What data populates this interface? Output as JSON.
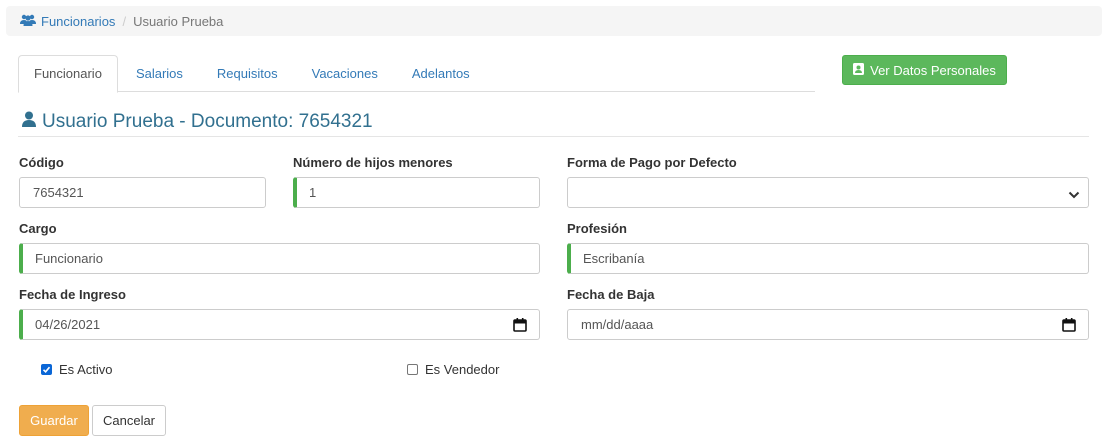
{
  "breadcrumb": {
    "parent": "Funcionarios",
    "current": "Usuario Prueba"
  },
  "tabs": [
    {
      "label": "Funcionario",
      "active": true
    },
    {
      "label": "Salarios"
    },
    {
      "label": "Requisitos"
    },
    {
      "label": "Vacaciones"
    },
    {
      "label": "Adelantos"
    }
  ],
  "personal_button": "Ver Datos Personales",
  "heading": "Usuario Prueba - Documento: 7654321",
  "form": {
    "codigo": {
      "label": "Código",
      "value": "7654321"
    },
    "hijos": {
      "label": "Número de hijos menores",
      "value": "1"
    },
    "forma_pago": {
      "label": "Forma de Pago por Defecto",
      "value": ""
    },
    "cargo": {
      "label": "Cargo",
      "value": "Funcionario"
    },
    "profesion": {
      "label": "Profesión",
      "value": "Escribanía"
    },
    "fecha_ingreso": {
      "label": "Fecha de Ingreso",
      "value": "04/26/2021"
    },
    "fecha_baja": {
      "label": "Fecha de Baja",
      "placeholder": "mm/dd/aaaa"
    },
    "es_activo": {
      "label": "Es Activo",
      "checked": true
    },
    "es_vendedor": {
      "label": "Es Vendedor",
      "checked": false
    }
  },
  "buttons": {
    "save": "Guardar",
    "cancel": "Cancelar"
  },
  "colors": {
    "link": "#337ab7",
    "success": "#5cb85c",
    "warning": "#f0ad4e",
    "heading": "#31708f",
    "valid_border": "#4cae4c"
  },
  "icons": [
    "users-icon",
    "id-card-icon",
    "user-icon",
    "calendar-icon",
    "chevron-down-icon",
    "check-icon"
  ]
}
